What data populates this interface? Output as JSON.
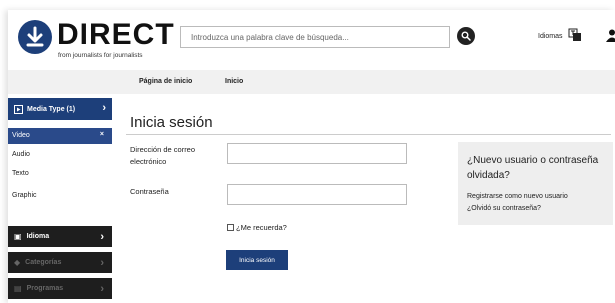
{
  "header": {
    "logo_word": "DIRECT",
    "logo_tagline": "from journalists for journalists",
    "search_placeholder": "Introduzca una palabra clave de búsqueda...",
    "languages_label": "Idiomas"
  },
  "nav": {
    "items": [
      "Página de inicio",
      "Inicio"
    ]
  },
  "sidebar": {
    "media_type_label": "Media Type (1)",
    "media_items": [
      "Video",
      "Audio",
      "Texto",
      "Graphic"
    ],
    "active_item": "Video",
    "sections": [
      "Idioma",
      "Categorías",
      "Programas"
    ]
  },
  "main": {
    "title": "Inicia sesión",
    "email_label": "Dirección de correo electrónico",
    "password_label": "Contraseña",
    "remember_label": "¿Me recuerda?",
    "submit_label": "Inicia sesión"
  },
  "aside": {
    "title": "¿Nuevo usuario o contraseña olvidada?",
    "register_link": "Registrarse como nuevo usuario",
    "forgot_link": "¿Olvidó su contraseña?"
  },
  "colors": {
    "brand": "#1d3f7a",
    "dark_panel": "#1e1e1e"
  }
}
